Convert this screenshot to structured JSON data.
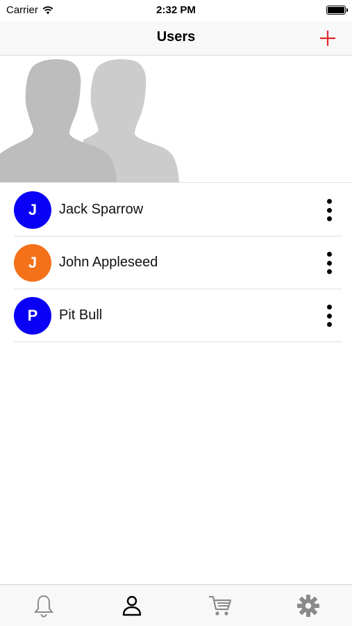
{
  "status_bar": {
    "carrier": "Carrier",
    "time": "2:32 PM"
  },
  "nav": {
    "title": "Users",
    "add_icon": "plus-icon",
    "accent_color": "#e0242c"
  },
  "users": [
    {
      "initial": "J",
      "name": "Jack Sparrow",
      "color": "#0a00f5"
    },
    {
      "initial": "J",
      "name": "John Appleseed",
      "color": "#f4711a"
    },
    {
      "initial": "P",
      "name": "Pit Bull",
      "color": "#0a00f5"
    }
  ],
  "tabs": [
    {
      "name": "notifications",
      "icon": "bell-icon",
      "selected": false
    },
    {
      "name": "users",
      "icon": "person-icon",
      "selected": true
    },
    {
      "name": "cart",
      "icon": "cart-icon",
      "selected": false
    },
    {
      "name": "settings",
      "icon": "gear-icon",
      "selected": false
    }
  ]
}
